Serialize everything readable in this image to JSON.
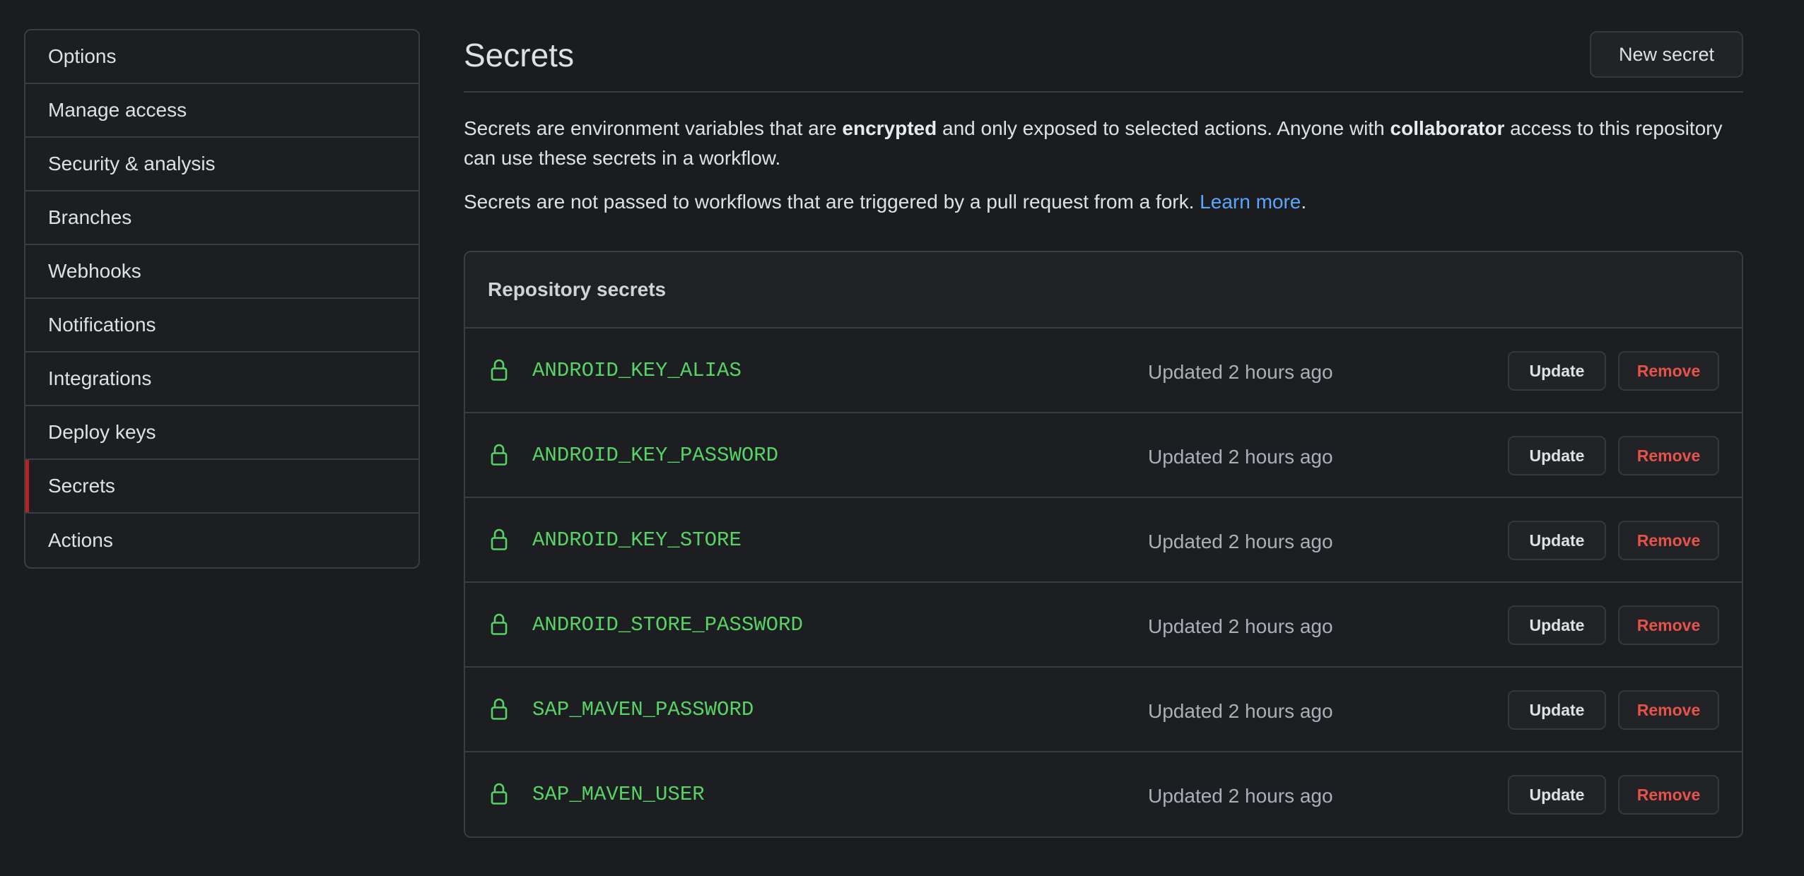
{
  "sidebar": {
    "items": [
      {
        "label": "Options"
      },
      {
        "label": "Manage access"
      },
      {
        "label": "Security & analysis"
      },
      {
        "label": "Branches"
      },
      {
        "label": "Webhooks"
      },
      {
        "label": "Notifications"
      },
      {
        "label": "Integrations"
      },
      {
        "label": "Deploy keys"
      },
      {
        "label": "Secrets",
        "active": true
      },
      {
        "label": "Actions"
      }
    ],
    "active_marker_color": "#b62324"
  },
  "header": {
    "title": "Secrets",
    "new_secret_label": "New secret"
  },
  "description": {
    "p1_part1": "Secrets are environment variables that are ",
    "p1_bold1": "encrypted",
    "p1_part2": " and only exposed to selected actions. Anyone with ",
    "p1_bold2": "collaborator",
    "p1_part3": " access to this repository can use these secrets in a workflow.",
    "p2_text": "Secrets are not passed to workflows that are triggered by a pull request from a fork. ",
    "p2_link": "Learn more",
    "p2_end": "."
  },
  "repository_secrets": {
    "heading": "Repository secrets",
    "update_label": "Update",
    "remove_label": "Remove",
    "rows": [
      {
        "name": "ANDROID_KEY_ALIAS",
        "updated": "Updated 2 hours ago"
      },
      {
        "name": "ANDROID_KEY_PASSWORD",
        "updated": "Updated 2 hours ago"
      },
      {
        "name": "ANDROID_KEY_STORE",
        "updated": "Updated 2 hours ago"
      },
      {
        "name": "ANDROID_STORE_PASSWORD",
        "updated": "Updated 2 hours ago"
      },
      {
        "name": "SAP_MAVEN_PASSWORD",
        "updated": "Updated 2 hours ago"
      },
      {
        "name": "SAP_MAVEN_USER",
        "updated": "Updated 2 hours ago"
      }
    ]
  },
  "icons": {
    "row_icon": "lock-icon"
  },
  "colors": {
    "background": "#1b1c1e",
    "secret_name": "#56d364",
    "link": "#58a6ff",
    "remove": "#e5534b"
  }
}
